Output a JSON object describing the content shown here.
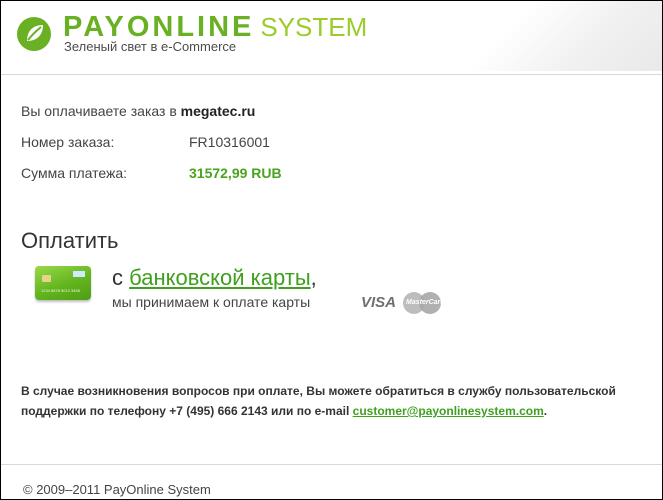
{
  "header": {
    "brand_pay": "PAYONLINE",
    "brand_system": "SYSTEM",
    "tagline": "Зеленый свет в e-Commerce",
    "logo_icon": "payonline-leaf-logo",
    "colors": {
      "brand_green": "#6ab023",
      "light_green": "#9ccc2c"
    }
  },
  "order": {
    "paying_for_label": "Вы оплачиваете заказ в",
    "merchant": "megatec.ru",
    "order_number_label": "Номер заказа:",
    "order_number": "FR10316001",
    "amount_label": "Сумма платежа:",
    "amount": "31572,99 RUB"
  },
  "payment": {
    "title": "Оплатить",
    "card_icon": "bank-card-icon",
    "method_prefix": "с",
    "method_link": "банковской карты",
    "method_suffix": ",",
    "accept_text": "мы принимаем к оплате карты",
    "visa_label": "VISA",
    "mastercard_label": "MasterCard",
    "card_number_text": "1234 5678 9012 3456"
  },
  "support": {
    "text": "В случае возникновения вопросов при оплате, Вы можете обратиться в службу пользовательской поддержки по телефону +7 (495) 666 2143 или по e-mail",
    "email": "customer@payonlinesystem.com",
    "end": "."
  },
  "footer": {
    "copyright": "© 2009–2011 PayOnline System"
  }
}
